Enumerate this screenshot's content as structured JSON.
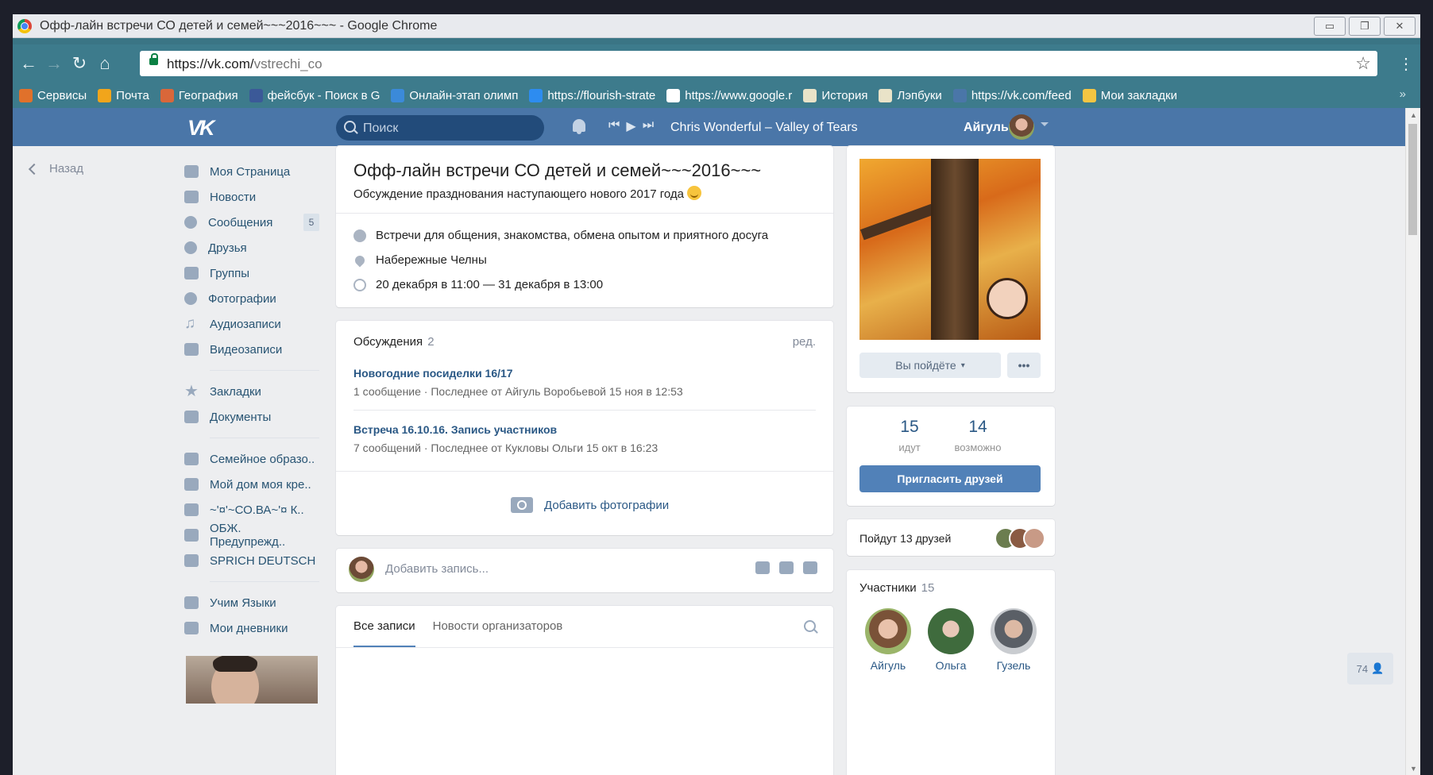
{
  "window": {
    "title": "Офф-лайн встречи СО детей и семей~~~2016~~~ - Google Chrome"
  },
  "browser": {
    "url_host": "https://vk.com/",
    "url_path": "vstrechi_co",
    "bookmarks": [
      {
        "label": "Сервисы",
        "color": "#e0712b"
      },
      {
        "label": "Почта",
        "color": "#f1a51b"
      },
      {
        "label": "География",
        "color": "#d9673a"
      },
      {
        "label": "фейсбук - Поиск в G",
        "color": "#3b5998"
      },
      {
        "label": "Онлайн-этап олимп",
        "color": "#3b8ad9"
      },
      {
        "label": "https://flourish-strate",
        "color": "#2d8cf0"
      },
      {
        "label": "https://www.google.r",
        "color": "#ffffff"
      },
      {
        "label": "История",
        "color": "#e9e3c8"
      },
      {
        "label": "Лэпбуки",
        "color": "#e9e3c8"
      },
      {
        "label": "https://vk.com/feed",
        "color": "#4a76a8"
      },
      {
        "label": "Мои закладки",
        "color": "#f4c542"
      }
    ]
  },
  "vk_header": {
    "logo": "VK",
    "search_placeholder": "Поиск",
    "track": "Chris Wonderful – Valley of Tears",
    "user_name": "Айгуль"
  },
  "back_label": "Назад",
  "left_menu": {
    "main": [
      {
        "label": "Моя Страница",
        "icon": "home-icon"
      },
      {
        "label": "Новости",
        "icon": "news-icon"
      },
      {
        "label": "Сообщения",
        "icon": "messages-icon",
        "badge": "5"
      },
      {
        "label": "Друзья",
        "icon": "friend-icon"
      },
      {
        "label": "Группы",
        "icon": "groups-icon"
      },
      {
        "label": "Фотографии",
        "icon": "camera-icon"
      },
      {
        "label": "Аудиозаписи",
        "icon": "music-icon"
      },
      {
        "label": "Видеозаписи",
        "icon": "video-icon"
      }
    ],
    "secondary": [
      {
        "label": "Закладки",
        "icon": "star-icon"
      },
      {
        "label": "Документы",
        "icon": "document-icon"
      }
    ],
    "groups": [
      {
        "label": "Семейное образо.."
      },
      {
        "label": "Мой дом моя кре.."
      },
      {
        "label": "~'¤'~СО.ВА~'¤ К.."
      },
      {
        "label": "ОБЖ. Предупрежд.."
      },
      {
        "label": "SPRICH DEUTSCH"
      }
    ],
    "apps": [
      {
        "label": "Учим Языки"
      },
      {
        "label": "Мои дневники"
      }
    ]
  },
  "event": {
    "title": "Офф-лайн встречи СО детей и семей~~~2016~~~",
    "status": "Обсуждение празднования наступающего нового 2017 года",
    "description": "Встречи для общения, знакомства, обмена опытом и приятного досуга",
    "location": "Набережные Челны",
    "dates": "20 декабря в 11:00 — 31 декабря в 13:00"
  },
  "discussions": {
    "header": "Обсуждения",
    "count": "2",
    "edit": "ред.",
    "topics": [
      {
        "title": "Новогодние посиделки 16/17",
        "meta": "1 сообщение  ·  Последнее от Айгуль Воробьевой 15 ноя в 12:53"
      },
      {
        "title": "Встреча 16.10.16. Запись участников",
        "meta": "7 сообщений  ·  Последнее от Кукловы Ольги 15 окт в 16:23"
      }
    ],
    "add_photos": "Добавить фотографии"
  },
  "post_box": {
    "placeholder": "Добавить запись..."
  },
  "wall_tabs": [
    "Все записи",
    "Новости организаторов"
  ],
  "right": {
    "rsvp_button": "Вы пойдёте",
    "more_button": "•••",
    "going_count": "15",
    "going_label": "идут",
    "maybe_count": "14",
    "maybe_label": "возможно",
    "invite_button": "Пригласить друзей",
    "friends_going": "Пойдут 13 друзей",
    "members_header": "Участники",
    "members_count": "15",
    "members": [
      {
        "name": "Айгуль"
      },
      {
        "name": "Ольга"
      },
      {
        "name": "Гузель"
      }
    ]
  },
  "online_count": "74"
}
